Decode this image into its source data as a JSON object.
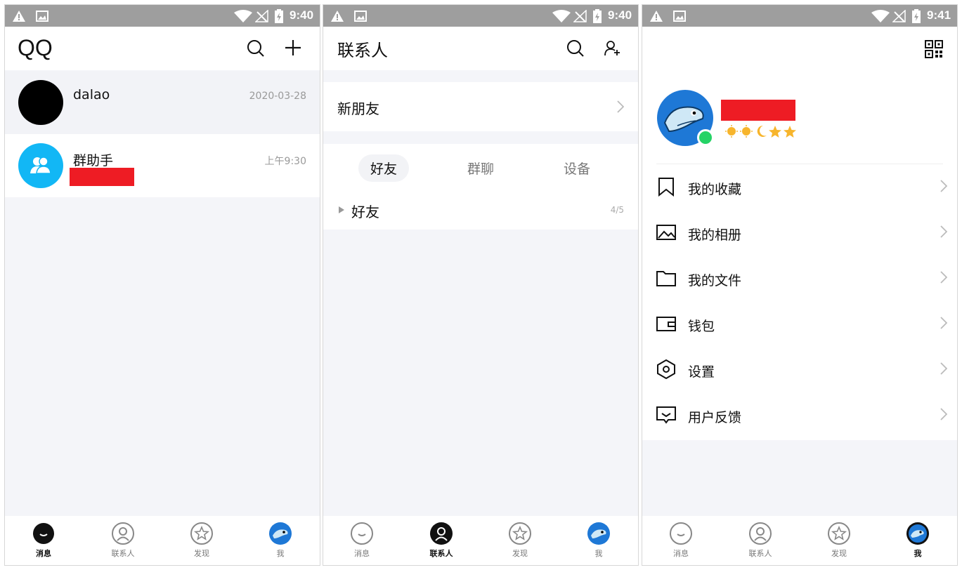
{
  "status_bars": [
    {
      "time": "9:40"
    },
    {
      "time": "9:40"
    },
    {
      "time": "9:41"
    }
  ],
  "tab_labels": [
    "消息",
    "联系人",
    "发现",
    "我"
  ],
  "messages_screen": {
    "app_title": "QQ",
    "conversations": [
      {
        "name": "dalao",
        "date": "2020-03-28"
      },
      {
        "name": "群助手",
        "date": "上午9:30"
      }
    ]
  },
  "contacts_screen": {
    "title": "联系人",
    "new_friends": "新朋友",
    "segments": [
      "好友",
      "群聊",
      "设备"
    ],
    "group": {
      "name": "好友",
      "count": "4/5"
    }
  },
  "me_screen": {
    "menu": [
      "我的收藏",
      "我的相册",
      "我的文件",
      "钱包",
      "设置",
      "用户反馈"
    ]
  },
  "colors": {
    "accent": "#12b7f5",
    "online": "#25d366",
    "redacted": "#ee1c24",
    "background": "#f4f5f9"
  }
}
